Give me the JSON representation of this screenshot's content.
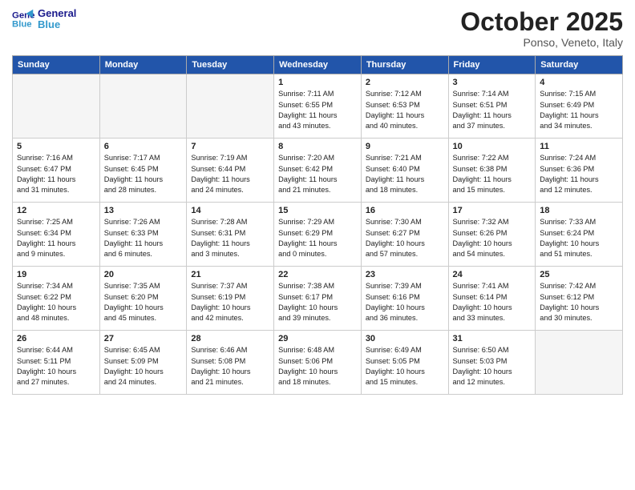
{
  "header": {
    "logo_line1": "General",
    "logo_line2": "Blue",
    "month": "October 2025",
    "location": "Ponso, Veneto, Italy"
  },
  "weekdays": [
    "Sunday",
    "Monday",
    "Tuesday",
    "Wednesday",
    "Thursday",
    "Friday",
    "Saturday"
  ],
  "weeks": [
    [
      {
        "num": "",
        "info": ""
      },
      {
        "num": "",
        "info": ""
      },
      {
        "num": "",
        "info": ""
      },
      {
        "num": "1",
        "info": "Sunrise: 7:11 AM\nSunset: 6:55 PM\nDaylight: 11 hours\nand 43 minutes."
      },
      {
        "num": "2",
        "info": "Sunrise: 7:12 AM\nSunset: 6:53 PM\nDaylight: 11 hours\nand 40 minutes."
      },
      {
        "num": "3",
        "info": "Sunrise: 7:14 AM\nSunset: 6:51 PM\nDaylight: 11 hours\nand 37 minutes."
      },
      {
        "num": "4",
        "info": "Sunrise: 7:15 AM\nSunset: 6:49 PM\nDaylight: 11 hours\nand 34 minutes."
      }
    ],
    [
      {
        "num": "5",
        "info": "Sunrise: 7:16 AM\nSunset: 6:47 PM\nDaylight: 11 hours\nand 31 minutes."
      },
      {
        "num": "6",
        "info": "Sunrise: 7:17 AM\nSunset: 6:45 PM\nDaylight: 11 hours\nand 28 minutes."
      },
      {
        "num": "7",
        "info": "Sunrise: 7:19 AM\nSunset: 6:44 PM\nDaylight: 11 hours\nand 24 minutes."
      },
      {
        "num": "8",
        "info": "Sunrise: 7:20 AM\nSunset: 6:42 PM\nDaylight: 11 hours\nand 21 minutes."
      },
      {
        "num": "9",
        "info": "Sunrise: 7:21 AM\nSunset: 6:40 PM\nDaylight: 11 hours\nand 18 minutes."
      },
      {
        "num": "10",
        "info": "Sunrise: 7:22 AM\nSunset: 6:38 PM\nDaylight: 11 hours\nand 15 minutes."
      },
      {
        "num": "11",
        "info": "Sunrise: 7:24 AM\nSunset: 6:36 PM\nDaylight: 11 hours\nand 12 minutes."
      }
    ],
    [
      {
        "num": "12",
        "info": "Sunrise: 7:25 AM\nSunset: 6:34 PM\nDaylight: 11 hours\nand 9 minutes."
      },
      {
        "num": "13",
        "info": "Sunrise: 7:26 AM\nSunset: 6:33 PM\nDaylight: 11 hours\nand 6 minutes."
      },
      {
        "num": "14",
        "info": "Sunrise: 7:28 AM\nSunset: 6:31 PM\nDaylight: 11 hours\nand 3 minutes."
      },
      {
        "num": "15",
        "info": "Sunrise: 7:29 AM\nSunset: 6:29 PM\nDaylight: 11 hours\nand 0 minutes."
      },
      {
        "num": "16",
        "info": "Sunrise: 7:30 AM\nSunset: 6:27 PM\nDaylight: 10 hours\nand 57 minutes."
      },
      {
        "num": "17",
        "info": "Sunrise: 7:32 AM\nSunset: 6:26 PM\nDaylight: 10 hours\nand 54 minutes."
      },
      {
        "num": "18",
        "info": "Sunrise: 7:33 AM\nSunset: 6:24 PM\nDaylight: 10 hours\nand 51 minutes."
      }
    ],
    [
      {
        "num": "19",
        "info": "Sunrise: 7:34 AM\nSunset: 6:22 PM\nDaylight: 10 hours\nand 48 minutes."
      },
      {
        "num": "20",
        "info": "Sunrise: 7:35 AM\nSunset: 6:20 PM\nDaylight: 10 hours\nand 45 minutes."
      },
      {
        "num": "21",
        "info": "Sunrise: 7:37 AM\nSunset: 6:19 PM\nDaylight: 10 hours\nand 42 minutes."
      },
      {
        "num": "22",
        "info": "Sunrise: 7:38 AM\nSunset: 6:17 PM\nDaylight: 10 hours\nand 39 minutes."
      },
      {
        "num": "23",
        "info": "Sunrise: 7:39 AM\nSunset: 6:16 PM\nDaylight: 10 hours\nand 36 minutes."
      },
      {
        "num": "24",
        "info": "Sunrise: 7:41 AM\nSunset: 6:14 PM\nDaylight: 10 hours\nand 33 minutes."
      },
      {
        "num": "25",
        "info": "Sunrise: 7:42 AM\nSunset: 6:12 PM\nDaylight: 10 hours\nand 30 minutes."
      }
    ],
    [
      {
        "num": "26",
        "info": "Sunrise: 6:44 AM\nSunset: 5:11 PM\nDaylight: 10 hours\nand 27 minutes."
      },
      {
        "num": "27",
        "info": "Sunrise: 6:45 AM\nSunset: 5:09 PM\nDaylight: 10 hours\nand 24 minutes."
      },
      {
        "num": "28",
        "info": "Sunrise: 6:46 AM\nSunset: 5:08 PM\nDaylight: 10 hours\nand 21 minutes."
      },
      {
        "num": "29",
        "info": "Sunrise: 6:48 AM\nSunset: 5:06 PM\nDaylight: 10 hours\nand 18 minutes."
      },
      {
        "num": "30",
        "info": "Sunrise: 6:49 AM\nSunset: 5:05 PM\nDaylight: 10 hours\nand 15 minutes."
      },
      {
        "num": "31",
        "info": "Sunrise: 6:50 AM\nSunset: 5:03 PM\nDaylight: 10 hours\nand 12 minutes."
      },
      {
        "num": "",
        "info": ""
      }
    ]
  ]
}
